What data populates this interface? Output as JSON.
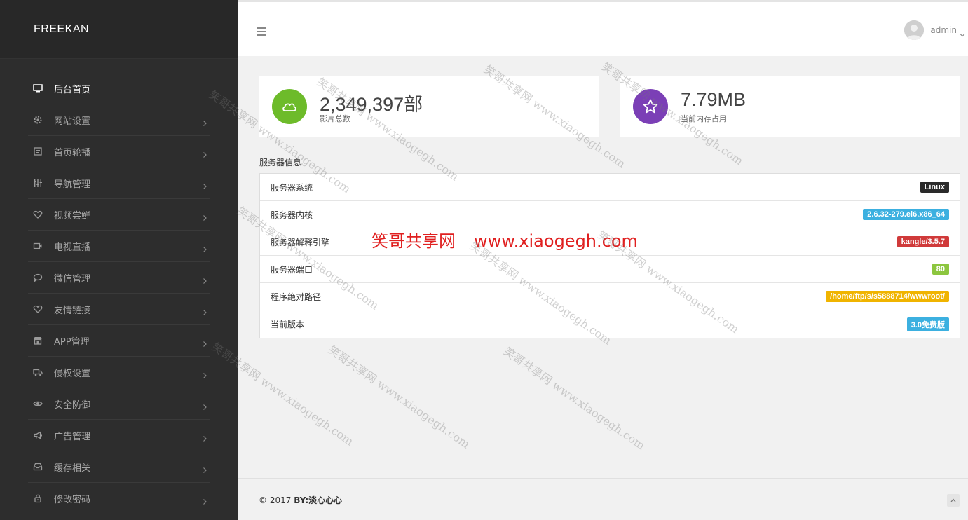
{
  "brand": "FREEKAN",
  "sidebar": {
    "items": [
      {
        "label": "后台首页",
        "icon": "monitor-icon",
        "active": true
      },
      {
        "label": "网站设置",
        "icon": "gear-icon"
      },
      {
        "label": "首页轮播",
        "icon": "calendar-icon"
      },
      {
        "label": "导航管理",
        "icon": "sliders-icon"
      },
      {
        "label": "视频尝鲜",
        "icon": "heart-icon"
      },
      {
        "label": "电视直播",
        "icon": "video-icon"
      },
      {
        "label": "微信管理",
        "icon": "chat-icon"
      },
      {
        "label": "友情链接",
        "icon": "heart-icon"
      },
      {
        "label": "APP管理",
        "icon": "store-icon"
      },
      {
        "label": "侵权设置",
        "icon": "truck-icon"
      },
      {
        "label": "安全防御",
        "icon": "eye-icon"
      },
      {
        "label": "广告管理",
        "icon": "megaphone-icon"
      },
      {
        "label": "缓存相关",
        "icon": "inbox-icon"
      },
      {
        "label": "修改密码",
        "icon": "lock-icon"
      }
    ]
  },
  "header": {
    "user_name": "admin"
  },
  "stats": {
    "movies": {
      "value": "2,349,397部",
      "label": "影片总数",
      "color": "#6dbb2a",
      "icon": "cloud-icon"
    },
    "memory": {
      "value": "7.79MB",
      "label": "当前内存占用",
      "color": "#7b3fb6",
      "icon": "star-icon"
    }
  },
  "server": {
    "title": "服务器信息",
    "rows": [
      {
        "key": "服务器系统",
        "value": "Linux",
        "color": "#2a2a2a"
      },
      {
        "key": "服务器内核",
        "value": "2.6.32-279.el6.x86_64",
        "color": "#3cb0e0"
      },
      {
        "key": "服务器解释引擎",
        "value": "kangle/3.5.7",
        "color": "#d03a3a"
      },
      {
        "key": "服务器端口",
        "value": "80",
        "color": "#8cc63f"
      },
      {
        "key": "程序绝对路径",
        "value": "/home/ftp/s/s5888714/wwwroot/",
        "color": "#f0b400"
      },
      {
        "key": "当前版本",
        "value": "3.0免费版",
        "color": "#3cb0e0"
      }
    ]
  },
  "watermark": {
    "center_cn": "笑哥共享网",
    "center_url": "www.xiaogegh.com",
    "diagonal": "笑哥共享网 www.xiaogegh.com"
  },
  "footer": {
    "copyright_prefix": "© 2017",
    "copyright_author": "BY:淡心心心"
  }
}
